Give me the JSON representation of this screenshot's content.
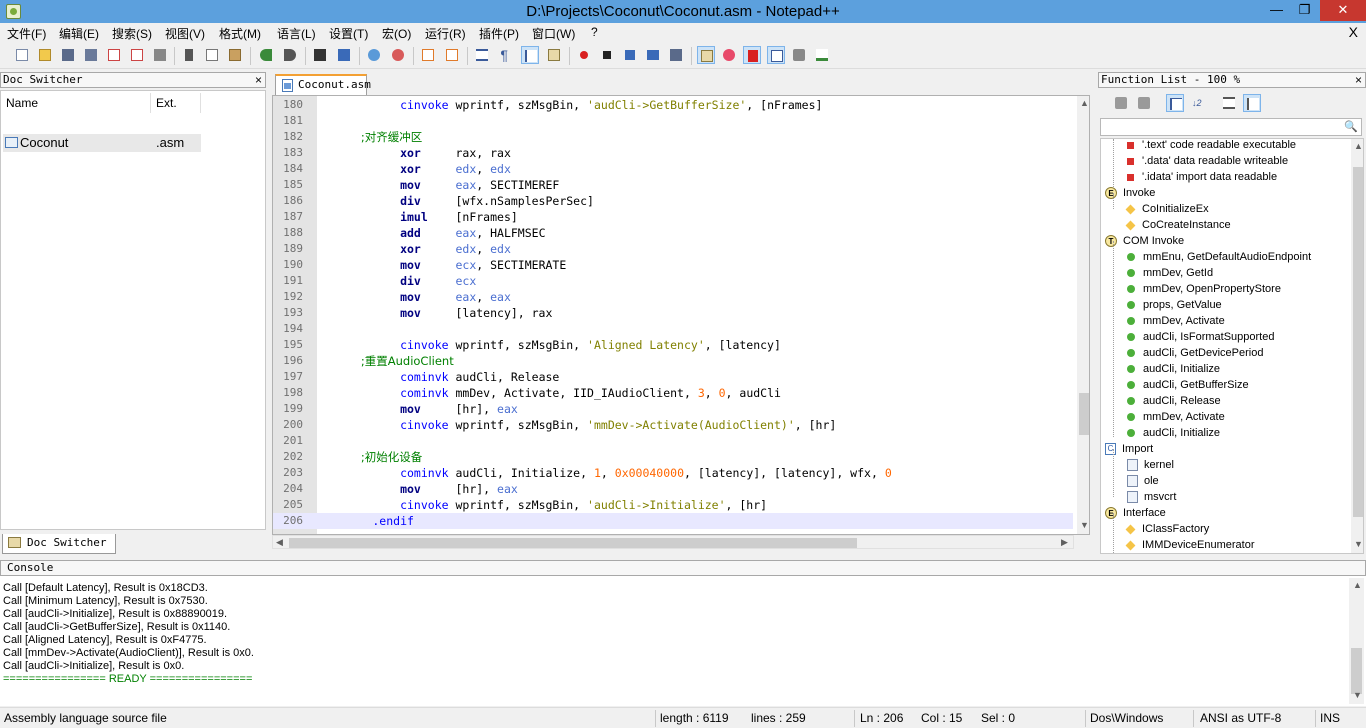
{
  "window": {
    "title": "D:\\Projects\\Coconut\\Coconut.asm - Notepad++",
    "minimize": "—",
    "maximize": "❐",
    "close": "✕"
  },
  "menu": {
    "items": [
      "文件(F)",
      "编辑(E)",
      "搜索(S)",
      "视图(V)",
      "格式(M)",
      "语言(L)",
      "设置(T)",
      "宏(O)",
      "运行(R)",
      "插件(P)",
      "窗口(W)",
      "?"
    ],
    "close_doc": "X"
  },
  "doc_switcher": {
    "title": "Doc Switcher",
    "close": "×",
    "col_name": "Name",
    "col_ext": "Ext.",
    "row": {
      "name": "Coconut",
      "ext": ".asm"
    },
    "tab_label": "Doc Switcher"
  },
  "editor": {
    "tab_label": "Coconut.asm",
    "lines": [
      {
        "n": "180",
        "t": [
          [
            "kw",
            "            cinvoke"
          ],
          [
            "plain",
            " wprintf, szMsgBin, "
          ],
          [
            "str",
            "'audCli->GetBufferSize'"
          ],
          [
            "plain",
            ", [nFrames]"
          ]
        ]
      },
      {
        "n": "181",
        "t": []
      },
      {
        "n": "182",
        "t": [
          [
            "cmt",
            "            ;对齐缓冲区"
          ]
        ]
      },
      {
        "n": "183",
        "t": [
          [
            "kwb",
            "            xor"
          ],
          [
            "plain",
            "     rax, rax"
          ]
        ]
      },
      {
        "n": "184",
        "t": [
          [
            "kwb",
            "            xor"
          ],
          [
            "plain",
            "     "
          ],
          [
            "reg",
            "edx"
          ],
          [
            "plain",
            ", "
          ],
          [
            "reg",
            "edx"
          ]
        ]
      },
      {
        "n": "185",
        "t": [
          [
            "kwb",
            "            mov"
          ],
          [
            "plain",
            "     "
          ],
          [
            "reg",
            "eax"
          ],
          [
            "plain",
            ", SECTIMEREF"
          ]
        ]
      },
      {
        "n": "186",
        "t": [
          [
            "kwb",
            "            div"
          ],
          [
            "plain",
            "     [wfx.nSamplesPerSec]"
          ]
        ]
      },
      {
        "n": "187",
        "t": [
          [
            "kwb",
            "            imul"
          ],
          [
            "plain",
            "    [nFrames]"
          ]
        ]
      },
      {
        "n": "188",
        "t": [
          [
            "kwb",
            "            add"
          ],
          [
            "plain",
            "     "
          ],
          [
            "reg",
            "eax"
          ],
          [
            "plain",
            ", HALFMSEC"
          ]
        ]
      },
      {
        "n": "189",
        "t": [
          [
            "kwb",
            "            xor"
          ],
          [
            "plain",
            "     "
          ],
          [
            "reg",
            "edx"
          ],
          [
            "plain",
            ", "
          ],
          [
            "reg",
            "edx"
          ]
        ]
      },
      {
        "n": "190",
        "t": [
          [
            "kwb",
            "            mov"
          ],
          [
            "plain",
            "     "
          ],
          [
            "reg",
            "ecx"
          ],
          [
            "plain",
            ", SECTIMERATE"
          ]
        ]
      },
      {
        "n": "191",
        "t": [
          [
            "kwb",
            "            div"
          ],
          [
            "plain",
            "     "
          ],
          [
            "reg",
            "ecx"
          ]
        ]
      },
      {
        "n": "192",
        "t": [
          [
            "kwb",
            "            mov"
          ],
          [
            "plain",
            "     "
          ],
          [
            "reg",
            "eax"
          ],
          [
            "plain",
            ", "
          ],
          [
            "reg",
            "eax"
          ]
        ]
      },
      {
        "n": "193",
        "t": [
          [
            "kwb",
            "            mov"
          ],
          [
            "plain",
            "     [latency], rax"
          ]
        ]
      },
      {
        "n": "194",
        "t": []
      },
      {
        "n": "195",
        "t": [
          [
            "kw",
            "            cinvoke"
          ],
          [
            "plain",
            " wprintf, szMsgBin, "
          ],
          [
            "str",
            "'Aligned Latency'"
          ],
          [
            "plain",
            ", [latency]"
          ]
        ]
      },
      {
        "n": "196",
        "t": [
          [
            "cmt",
            "            ;重置AudioClient"
          ]
        ]
      },
      {
        "n": "197",
        "t": [
          [
            "kw",
            "            cominvk"
          ],
          [
            "plain",
            " audCli, Release"
          ]
        ]
      },
      {
        "n": "198",
        "t": [
          [
            "kw",
            "            cominvk"
          ],
          [
            "plain",
            " mmDev, Activate, IID_IAudioClient, "
          ],
          [
            "num",
            "3"
          ],
          [
            "plain",
            ", "
          ],
          [
            "num",
            "0"
          ],
          [
            "plain",
            ", audCli"
          ]
        ]
      },
      {
        "n": "199",
        "t": [
          [
            "kwb",
            "            mov"
          ],
          [
            "plain",
            "     [hr], "
          ],
          [
            "reg",
            "eax"
          ]
        ]
      },
      {
        "n": "200",
        "t": [
          [
            "kw",
            "            cinvoke"
          ],
          [
            "plain",
            " wprintf, szMsgBin, "
          ],
          [
            "str",
            "'mmDev->Activate(AudioClient)'"
          ],
          [
            "plain",
            ", [hr]"
          ]
        ]
      },
      {
        "n": "201",
        "t": []
      },
      {
        "n": "202",
        "t": [
          [
            "cmt",
            "            ;初始化设备"
          ]
        ]
      },
      {
        "n": "203",
        "t": [
          [
            "kw",
            "            cominvk"
          ],
          [
            "plain",
            " audCli, Initialize, "
          ],
          [
            "num",
            "1"
          ],
          [
            "plain",
            ", "
          ],
          [
            "num",
            "0x00040000"
          ],
          [
            "plain",
            ", [latency], [latency], wfx, "
          ],
          [
            "num",
            "0"
          ]
        ]
      },
      {
        "n": "204",
        "t": [
          [
            "kwb",
            "            mov"
          ],
          [
            "plain",
            "     [hr], "
          ],
          [
            "reg",
            "eax"
          ]
        ]
      },
      {
        "n": "205",
        "t": [
          [
            "kw",
            "            cinvoke"
          ],
          [
            "plain",
            " wprintf, szMsgBin, "
          ],
          [
            "str",
            "'audCli->Initialize'"
          ],
          [
            "plain",
            ", [hr]"
          ]
        ]
      },
      {
        "n": "206",
        "t": [
          [
            "kw",
            "        .endif"
          ]
        ]
      }
    ]
  },
  "function_list": {
    "title": "Function List - 100 %",
    "close": "×",
    "search_icon": "magnifier-icon",
    "items": [
      {
        "indent": 2,
        "icon": "red",
        "label": "'.text' code readable executable"
      },
      {
        "indent": 2,
        "icon": "red",
        "label": "'.data' data readable writeable"
      },
      {
        "indent": 2,
        "icon": "red",
        "label": "'.idata' import data readable"
      },
      {
        "indent": 1,
        "icon": "grp",
        "glyph": "E",
        "label": "Invoke"
      },
      {
        "indent": 2,
        "icon": "dia",
        "label": "CoInitializeEx"
      },
      {
        "indent": 2,
        "icon": "dia",
        "label": "CoCreateInstance"
      },
      {
        "indent": 1,
        "icon": "grp",
        "glyph": "T",
        "label": "COM Invoke"
      },
      {
        "indent": 2,
        "icon": "grn",
        "label": "mmEnu, GetDefaultAudioEndpoint"
      },
      {
        "indent": 2,
        "icon": "grn",
        "label": "mmDev, GetId"
      },
      {
        "indent": 2,
        "icon": "grn",
        "label": "mmDev, OpenPropertyStore"
      },
      {
        "indent": 2,
        "icon": "grn",
        "label": "props, GetValue"
      },
      {
        "indent": 2,
        "icon": "grn",
        "label": "mmDev, Activate"
      },
      {
        "indent": 2,
        "icon": "grn",
        "label": "audCli, IsFormatSupported"
      },
      {
        "indent": 2,
        "icon": "grn",
        "label": "audCli, GetDevicePeriod"
      },
      {
        "indent": 2,
        "icon": "grn",
        "label": "audCli, Initialize"
      },
      {
        "indent": 2,
        "icon": "grn",
        "label": "audCli, GetBufferSize"
      },
      {
        "indent": 2,
        "icon": "grn",
        "label": "audCli, Release"
      },
      {
        "indent": 2,
        "icon": "grn",
        "label": "mmDev, Activate"
      },
      {
        "indent": 2,
        "icon": "grn",
        "label": "audCli, Initialize"
      },
      {
        "indent": 1,
        "icon": "cls",
        "glyph": "C",
        "label": "Import"
      },
      {
        "indent": 2,
        "icon": "doc",
        "label": "kernel"
      },
      {
        "indent": 2,
        "icon": "doc",
        "label": "ole"
      },
      {
        "indent": 2,
        "icon": "doc",
        "label": "msvcrt"
      },
      {
        "indent": 1,
        "icon": "grp",
        "glyph": "E",
        "label": "Interface"
      },
      {
        "indent": 2,
        "icon": "dia",
        "label": "IClassFactory"
      },
      {
        "indent": 2,
        "icon": "dia",
        "label": "IMMDeviceEnumerator"
      }
    ]
  },
  "console": {
    "title": "Console",
    "lines": [
      "Call [Default Latency], Result is 0x18CD3.",
      "Call [Minimum Latency], Result is 0x7530.",
      "Call [audCli->Initialize], Result is 0x88890019.",
      "Call [audCli->GetBufferSize], Result is 0x1140.",
      "Call [Aligned Latency], Result is 0xF4775.",
      "Call [mmDev->Activate(AudioClient)], Result is 0x0.",
      "Call [audCli->Initialize], Result is 0x0."
    ],
    "ready": "================ READY ================"
  },
  "status": {
    "language": "Assembly language source file",
    "length": "length : 6119",
    "lines": "lines : 259",
    "ln": "Ln : 206",
    "col": "Col : 15",
    "sel": "Sel : 0",
    "eol": "Dos\\Windows",
    "encoding": "ANSI as UTF-8",
    "mode": "INS"
  }
}
